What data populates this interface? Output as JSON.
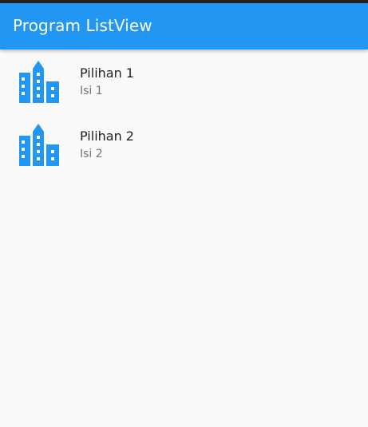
{
  "app_bar": {
    "title": "Program ListView",
    "color": "#2196f3"
  },
  "list": {
    "items": [
      {
        "icon": "location-city-icon",
        "title": "Pilihan 1",
        "subtitle": "Isi 1"
      },
      {
        "icon": "location-city-icon",
        "title": "Pilihan 2",
        "subtitle": "Isi 2"
      }
    ]
  }
}
